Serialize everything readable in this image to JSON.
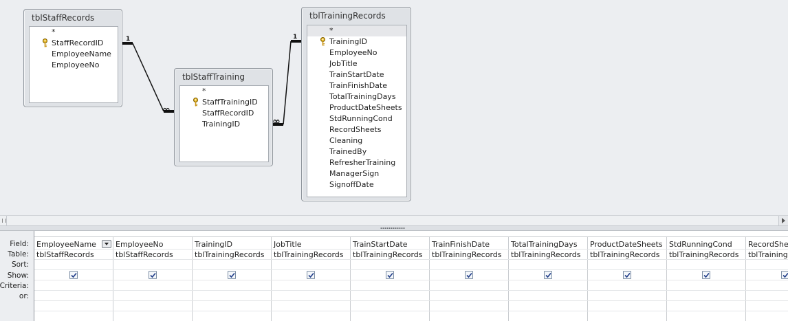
{
  "tables": [
    {
      "title": "tblStaffRecords",
      "fields": [
        {
          "label": "*",
          "key": false
        },
        {
          "label": "StaffRecordID",
          "key": true
        },
        {
          "label": "EmployeeName",
          "key": false
        },
        {
          "label": "EmployeeNo",
          "key": false
        }
      ]
    },
    {
      "title": "tblStaffTraining",
      "fields": [
        {
          "label": "*",
          "key": false
        },
        {
          "label": "StaffTrainingID",
          "key": true
        },
        {
          "label": "StaffRecordID",
          "key": false
        },
        {
          "label": "TrainingID",
          "key": false
        }
      ]
    },
    {
      "title": "tblTrainingRecords",
      "fields": [
        {
          "label": "*",
          "key": false
        },
        {
          "label": "TrainingID",
          "key": true
        },
        {
          "label": "EmployeeNo",
          "key": false
        },
        {
          "label": "JobTitle",
          "key": false
        },
        {
          "label": "TrainStartDate",
          "key": false
        },
        {
          "label": "TrainFinishDate",
          "key": false
        },
        {
          "label": "TotalTrainingDays",
          "key": false
        },
        {
          "label": "ProductDateSheets",
          "key": false
        },
        {
          "label": "StdRunningCond",
          "key": false
        },
        {
          "label": "RecordSheets",
          "key": false
        },
        {
          "label": "Cleaning",
          "key": false
        },
        {
          "label": "TrainedBy",
          "key": false
        },
        {
          "label": "RefresherTraining",
          "key": false
        },
        {
          "label": "ManagerSign",
          "key": false
        },
        {
          "label": "SignoffDate",
          "key": false
        }
      ]
    }
  ],
  "relationships": [
    {
      "one_label": "1",
      "many_label": "∞"
    },
    {
      "one_label": "1",
      "many_label": "∞"
    }
  ],
  "grid": {
    "row_labels": [
      "Field:",
      "Table:",
      "Sort:",
      "Show:",
      "Criteria:",
      "or:"
    ],
    "columns": [
      {
        "field": "EmployeeName",
        "table": "tblStaffRecords",
        "show": true,
        "dropdown": true
      },
      {
        "field": "EmployeeNo",
        "table": "tblStaffRecords",
        "show": true,
        "dropdown": false
      },
      {
        "field": "TrainingID",
        "table": "tblTrainingRecords",
        "show": true,
        "dropdown": false
      },
      {
        "field": "JobTitle",
        "table": "tblTrainingRecords",
        "show": true,
        "dropdown": false
      },
      {
        "field": "TrainStartDate",
        "table": "tblTrainingRecords",
        "show": true,
        "dropdown": false
      },
      {
        "field": "TrainFinishDate",
        "table": "tblTrainingRecords",
        "show": true,
        "dropdown": false
      },
      {
        "field": "TotalTrainingDays",
        "table": "tblTrainingRecords",
        "show": true,
        "dropdown": false
      },
      {
        "field": "ProductDateSheets",
        "table": "tblTrainingRecords",
        "show": true,
        "dropdown": false
      },
      {
        "field": "StdRunningCond",
        "table": "tblTrainingRecords",
        "show": true,
        "dropdown": false
      },
      {
        "field": "RecordSheets",
        "table": "tblTrainingRecords",
        "show": true,
        "dropdown": false
      }
    ]
  }
}
